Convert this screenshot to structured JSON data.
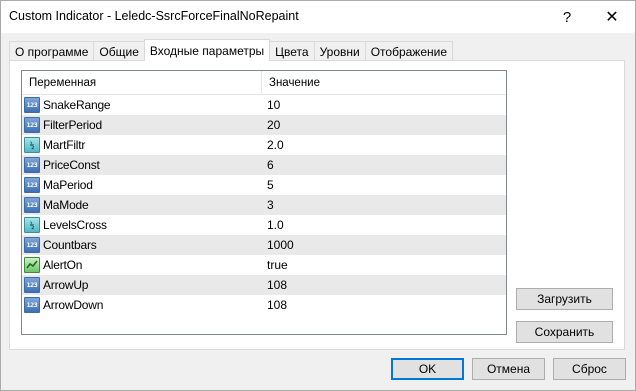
{
  "window": {
    "title": "Custom Indicator - Leledc-SsrcForceFinalNoRepaint",
    "help_glyph": "?",
    "close_glyph": "✕"
  },
  "tabs": [
    {
      "label": "О программе",
      "active": false
    },
    {
      "label": "Общие",
      "active": false
    },
    {
      "label": "Входные параметры",
      "active": true
    },
    {
      "label": "Цвета",
      "active": false
    },
    {
      "label": "Уровни",
      "active": false
    },
    {
      "label": "Отображение",
      "active": false
    }
  ],
  "table": {
    "columns": [
      "Переменная",
      "Значение"
    ],
    "rows": [
      {
        "icon": "int-type-icon",
        "icon_text": "123",
        "name": "SnakeRange",
        "value": "10"
      },
      {
        "icon": "int-type-icon",
        "icon_text": "123",
        "name": "FilterPeriod",
        "value": "20"
      },
      {
        "icon": "double-type-icon",
        "icon_text": "½",
        "name": "MartFiltr",
        "value": "2.0"
      },
      {
        "icon": "int-type-icon",
        "icon_text": "123",
        "name": "PriceConst",
        "value": "6"
      },
      {
        "icon": "int-type-icon",
        "icon_text": "123",
        "name": "MaPeriod",
        "value": "5"
      },
      {
        "icon": "int-type-icon",
        "icon_text": "123",
        "name": "MaMode",
        "value": "3"
      },
      {
        "icon": "double-type-icon",
        "icon_text": "½",
        "name": "LevelsCross",
        "value": "1.0"
      },
      {
        "icon": "int-type-icon",
        "icon_text": "123",
        "name": "Countbars",
        "value": "1000"
      },
      {
        "icon": "bool-type-icon",
        "icon_text": "",
        "name": "AlertOn",
        "value": "true"
      },
      {
        "icon": "int-type-icon",
        "icon_text": "123",
        "name": "ArrowUp",
        "value": "108"
      },
      {
        "icon": "int-type-icon",
        "icon_text": "123",
        "name": "ArrowDown",
        "value": "108"
      }
    ]
  },
  "buttons": {
    "load": "Загрузить",
    "save": "Сохранить",
    "ok": "OK",
    "cancel": "Отмена",
    "reset": "Сброс"
  },
  "colors": {
    "accent": "#0078d7",
    "row_alt": "#e9e9e9"
  }
}
